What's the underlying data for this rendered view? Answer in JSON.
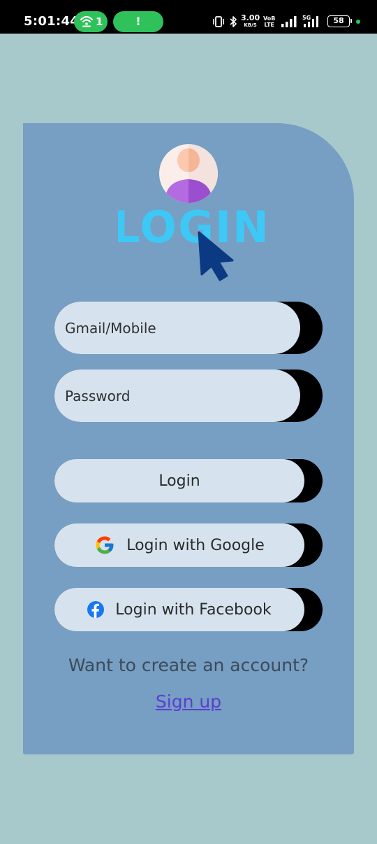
{
  "status_bar": {
    "time": "5:01:44",
    "hotspot_count": "1",
    "alert_symbol": "!",
    "net_speed": "3.00",
    "net_unit": "KB/S",
    "volte_top": "VoB",
    "volte_bottom": "LTE",
    "battery": "58",
    "icons": [
      "wifi-hotspot-icon",
      "vibrate-icon",
      "bluetooth-icon",
      "signal-icon",
      "5g-signal-icon",
      "battery-icon"
    ]
  },
  "login": {
    "logo_text": "LOGIN",
    "email_placeholder": "Gmail/Mobile",
    "password_placeholder": "Password",
    "login_button": "Login",
    "google_button": "Login with Google",
    "facebook_button": "Login with Facebook",
    "signup_prompt": "Want to create an account?",
    "signup_link": "Sign up"
  },
  "colors": {
    "background": "#a7c9cb",
    "card": "#779ec3",
    "field": "#d6e3ee",
    "logo_text": "#3ec8f5",
    "cursor": "#0b3a82",
    "link": "#5b3fd1",
    "status_pill": "#2fc15a"
  }
}
